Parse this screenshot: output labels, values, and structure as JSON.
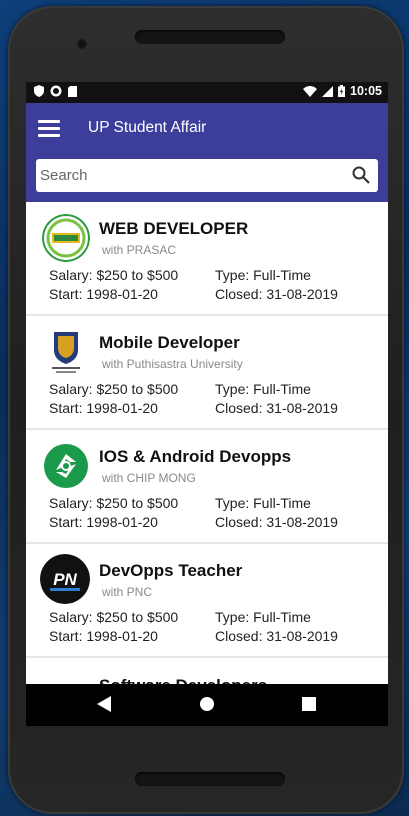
{
  "status": {
    "time": "10:05"
  },
  "app": {
    "title": "UP Student Affair"
  },
  "search": {
    "placeholder": "Search"
  },
  "jobs": [
    {
      "title": "WEB DEVELOPER",
      "company": "with PRASAC",
      "salary": "Salary: $250 to $500",
      "start": "Start: 1998-01-20",
      "type": "Type: Full-Time",
      "closed": "Closed: 31-08-2019",
      "logo": "prasac-logo-icon"
    },
    {
      "title": "Mobile Developer",
      "company": "with Puthisastra University",
      "salary": "Salary: $250 to $500",
      "start": "Start: 1998-01-20",
      "type": "Type: Full-Time",
      "closed": "Closed: 31-08-2019",
      "logo": "puthisastra-logo-icon"
    },
    {
      "title": "IOS & Android Devopps",
      "company": "with CHIP MONG",
      "salary": "Salary: $250 to $500",
      "start": "Start: 1998-01-20",
      "type": "Type: Full-Time",
      "closed": "Closed: 31-08-2019",
      "logo": "chip-mong-logo-icon"
    },
    {
      "title": "DevOpps Teacher",
      "company": "with PNC",
      "salary": "Salary: $250 to $500",
      "start": "Start: 1998-01-20",
      "type": "Type: Full-Time",
      "closed": "Closed: 31-08-2019",
      "logo": "pnc-logo-icon"
    },
    {
      "title": "Software Developers"
    }
  ],
  "logos": {
    "pnc_text": "PN"
  },
  "colors": {
    "appbar": "#3d3e9c",
    "accent_green": "#1a9a4a"
  }
}
